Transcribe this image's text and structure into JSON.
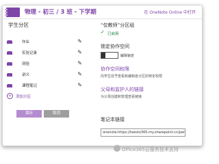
{
  "header": {
    "title": "物理 - 初三 / 3 班 - 下学期",
    "open_link": "在 OneNote Online 中打开"
  },
  "sections": {
    "title": "学生分区",
    "items": [
      {
        "label": "作业"
      },
      {
        "label": "实验记录"
      },
      {
        "label": "测验"
      },
      {
        "label": "讲义"
      },
      {
        "label": "课程笔记"
      }
    ],
    "add_label": "添加分区"
  },
  "buttons": {
    "save": "保存",
    "cancel": "取消"
  },
  "right": {
    "teacher_only_title": "“仅教师”分区组",
    "enabled": "已启用",
    "lock_title": "锁定协作空间",
    "toggle_label": "解除锁定",
    "permissions_link": "协作空间权限",
    "permissions_desc": "向学生授予查看和编辑各分区的特定权限",
    "parent_link": "父母和监护人的链接",
    "parent_desc": "为父母创建和管理查看链接",
    "notebook_link_title": "笔记本链接",
    "notebook_link_value": "onenote:https://teesto365-my.sharepoint.cn/per"
  },
  "watermark": "Office365云服务技术支持",
  "colors": {
    "accent": "#7e45a8",
    "save_button": "#b48ccf",
    "cancel_button": "#9e9e9e",
    "enabled_green": "#1b7d3c"
  },
  "icons": {
    "section_tab": "section-tab-icon",
    "edit": "pencil-icon",
    "add": "plus-circle-icon",
    "check": "check-icon"
  }
}
